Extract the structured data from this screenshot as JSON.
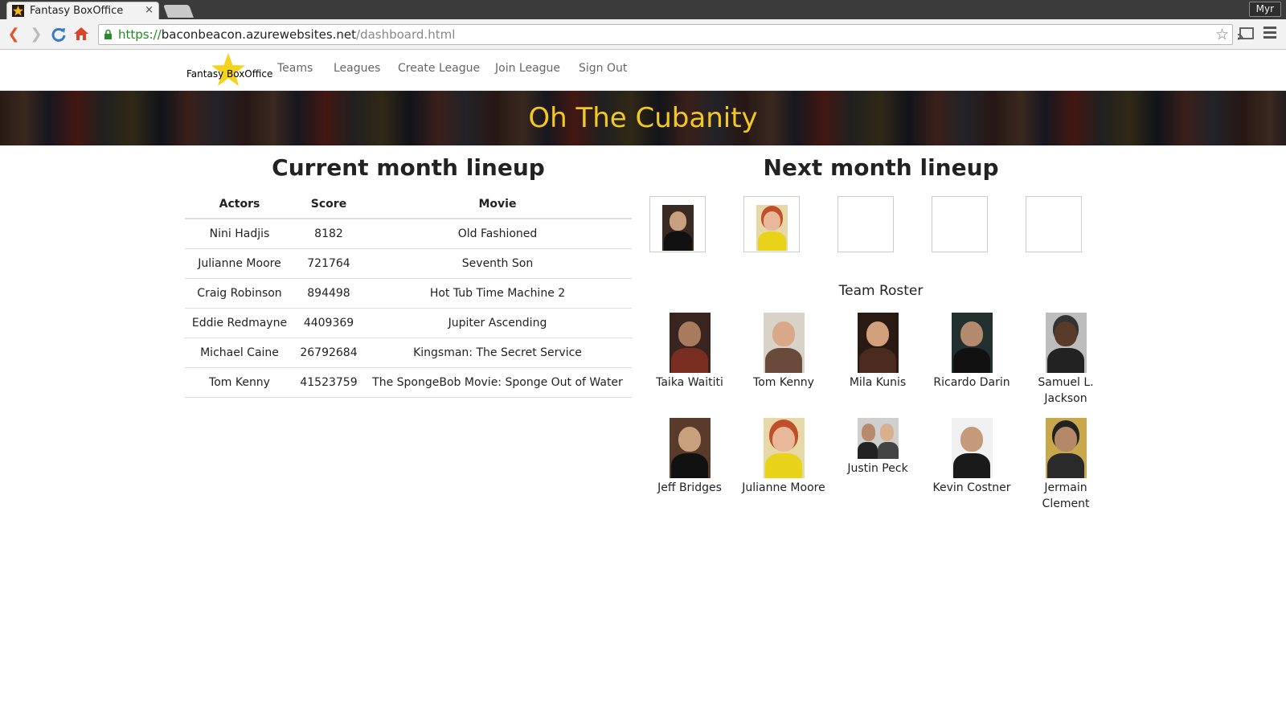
{
  "browser": {
    "tab_title": "Fantasy BoxOffice",
    "tab_close": "×",
    "profile": "Myr",
    "url_scheme": "https://",
    "url_host": "baconbeacon.azurewebsites.net",
    "url_path": "/dashboard.html"
  },
  "nav": {
    "brand_part1": "Fantasy ",
    "brand_part2": "BoxOffice",
    "links": [
      "Teams",
      "Leagues",
      "Create League",
      "Join League",
      "Sign Out"
    ]
  },
  "banner": {
    "title": "Oh The Cubanity"
  },
  "current": {
    "heading": "Current month lineup",
    "columns": [
      "Actors",
      "Score",
      "Movie"
    ],
    "rows": [
      [
        "Nini Hadjis",
        "8182",
        "Old Fashioned"
      ],
      [
        "Julianne Moore",
        "721764",
        "Seventh Son"
      ],
      [
        "Craig Robinson",
        "894498",
        "Hot Tub Time Machine 2"
      ],
      [
        "Eddie Redmayne",
        "4409369",
        "Jupiter Ascending"
      ],
      [
        "Michael Caine",
        "26792684",
        "Kingsman: The Secret Service"
      ],
      [
        "Tom Kenny",
        "41523759",
        "The SpongeBob Movie: Sponge Out of Water"
      ]
    ]
  },
  "next": {
    "heading": "Next month lineup"
  },
  "roster": {
    "title": "Team Roster",
    "row1": [
      "Taika Waititi",
      "Tom Kenny",
      "Mila Kunis",
      "Ricardo Darin",
      "Samuel L. Jackson"
    ],
    "row2": [
      "Jeff Bridges",
      "Julianne Moore",
      "Justin Peck",
      "Kevin Costner",
      "Jermain Clement"
    ]
  },
  "colors": {
    "banner_title": "#f3c820",
    "url_scheme": "#1f8a1f",
    "star": "#f5d21b"
  }
}
